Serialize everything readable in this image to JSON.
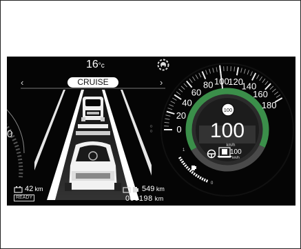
{
  "cluster": {
    "outside_temp": "16",
    "temp_unit": "°c",
    "drive_mode": "CRUISE",
    "nav_left": "‹",
    "nav_right": "›",
    "range_left_value": "42",
    "range_left_unit": "km",
    "ready_label": "READY",
    "range_right_value": "549",
    "range_right_unit": "km",
    "odometer": "000198",
    "odometer_unit": "km",
    "left_gauge_zero": "0",
    "speed": "100",
    "speed_unit": "km/h",
    "speed_limit": "100",
    "cruise_set_speed": "100",
    "cruise_set_unit": "km/h",
    "speed_scale": [
      "0",
      "20",
      "40",
      "60",
      "80",
      "100",
      "120",
      "140",
      "160",
      "180"
    ],
    "fuel_full": "1",
    "fuel_empty": "0",
    "dots_indicator": "○○"
  },
  "colors": {
    "background": "#050505",
    "ring_green": "#3b8f4a",
    "ring_dark": "#2a2a2a",
    "text": "#ffffff"
  },
  "icons": [
    "battery-icon",
    "fuel-pump-icon",
    "steering-wheel-icon",
    "lane-keep-icon",
    "sensor-warning-icon"
  ]
}
